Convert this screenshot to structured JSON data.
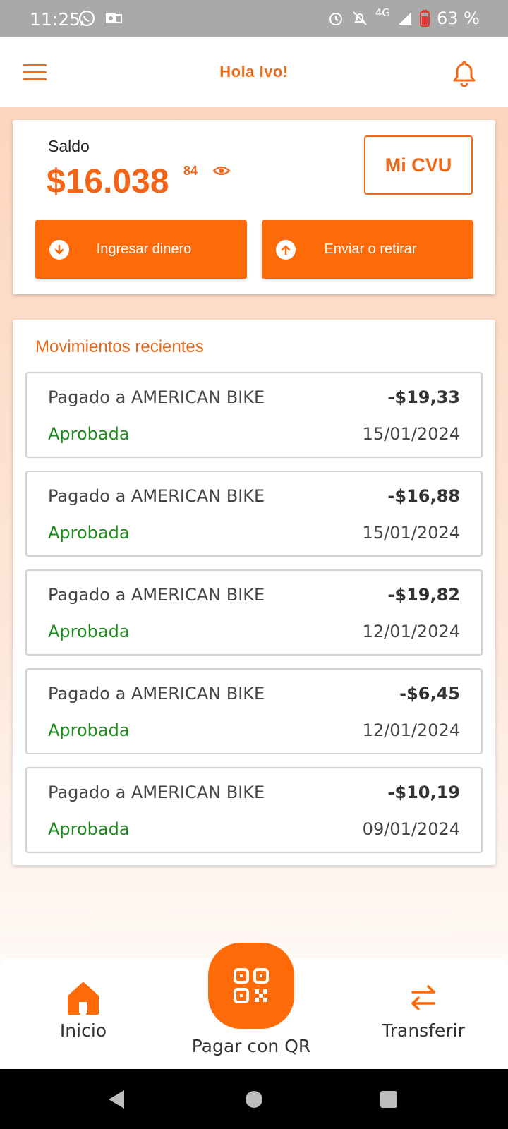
{
  "status_bar": {
    "time": "11:25",
    "network": "4G",
    "battery": "63 %"
  },
  "header": {
    "title": "Hola Ivo!"
  },
  "balance": {
    "label": "Saldo",
    "amount": "$16.038",
    "cents": "84",
    "cvu_button": "Mi CVU",
    "deposit_button": "Ingresar dinero",
    "send_button": "Enviar o retirar"
  },
  "movements": {
    "title": "Movimientos recientes",
    "items": [
      {
        "description": "Pagado a AMERICAN BIKE",
        "amount": "-$19,33",
        "status": "Aprobada",
        "date": "15/01/2024"
      },
      {
        "description": "Pagado a AMERICAN BIKE",
        "amount": "-$16,88",
        "status": "Aprobada",
        "date": "15/01/2024"
      },
      {
        "description": "Pagado a AMERICAN BIKE",
        "amount": "-$19,82",
        "status": "Aprobada",
        "date": "12/01/2024"
      },
      {
        "description": "Pagado a AMERICAN BIKE",
        "amount": "-$6,45",
        "status": "Aprobada",
        "date": "12/01/2024"
      },
      {
        "description": "Pagado a AMERICAN BIKE",
        "amount": "-$10,19",
        "status": "Aprobada",
        "date": "09/01/2024"
      }
    ]
  },
  "bottom_nav": {
    "home": "Inicio",
    "qr": "Pagar con QR",
    "transfer": "Transferir"
  },
  "colors": {
    "accent": "#ff6a09",
    "approved": "#1d8a1d"
  }
}
